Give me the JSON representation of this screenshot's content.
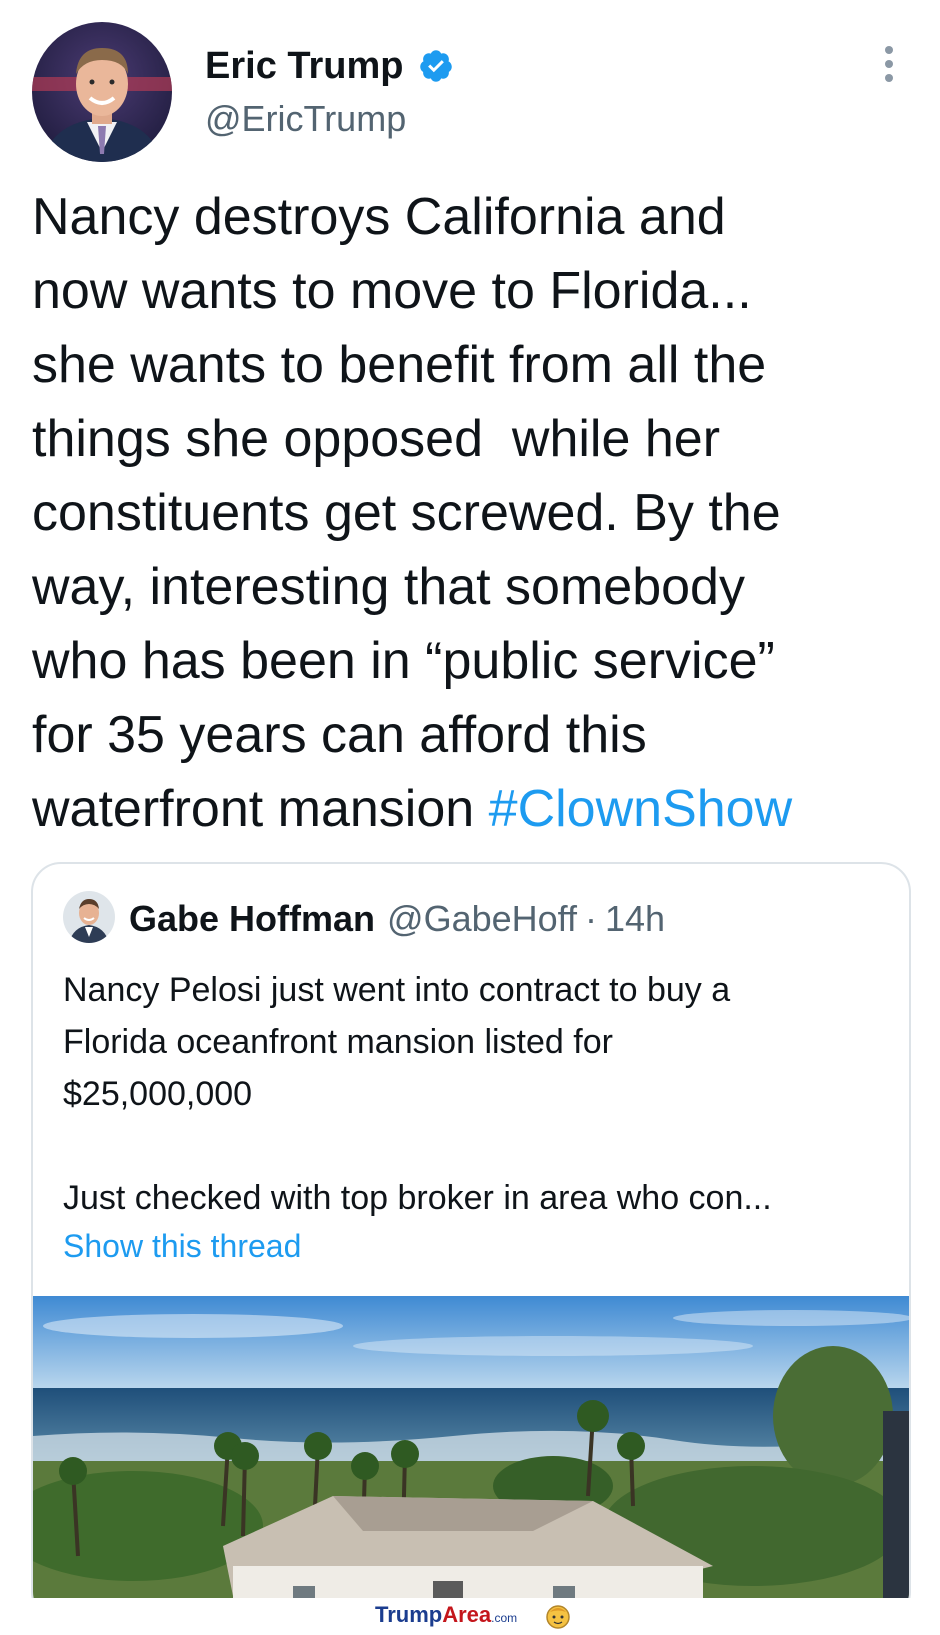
{
  "author": {
    "name": "Eric Trump",
    "handle": "@EricTrump",
    "verified": true,
    "avatar_icon": "profile-photo"
  },
  "tweet": {
    "text": "Nancy destroys California and\nnow wants to move to Florida...\nshe wants to benefit from all the\nthings she opposed  while her\nconstituents get screwed. By the\nway, interesting that somebody\nwho has been in “public service”\nfor 35 years can afford this\nwaterfront mansion ",
    "hashtag": "#ClownShow"
  },
  "quoted_tweet": {
    "name": "Gabe Hoffman",
    "handle": "@GabeHoff",
    "separator": "·",
    "time": "14h",
    "text": "Nancy Pelosi just went into contract to buy a\nFlorida oceanfront mansion listed for\n$25,000,000",
    "text_continued": "Just checked with top broker in area who con...",
    "show_thread": "Show this thread",
    "image_icon": "oceanfront-mansion-photo"
  },
  "footer": {
    "brand_part1": "Trump",
    "brand_part2": "Area",
    "brand_suffix": ".com"
  },
  "colors": {
    "link": "#1d9bf0",
    "secondary_text": "#536471",
    "border": "#dde3e8"
  }
}
